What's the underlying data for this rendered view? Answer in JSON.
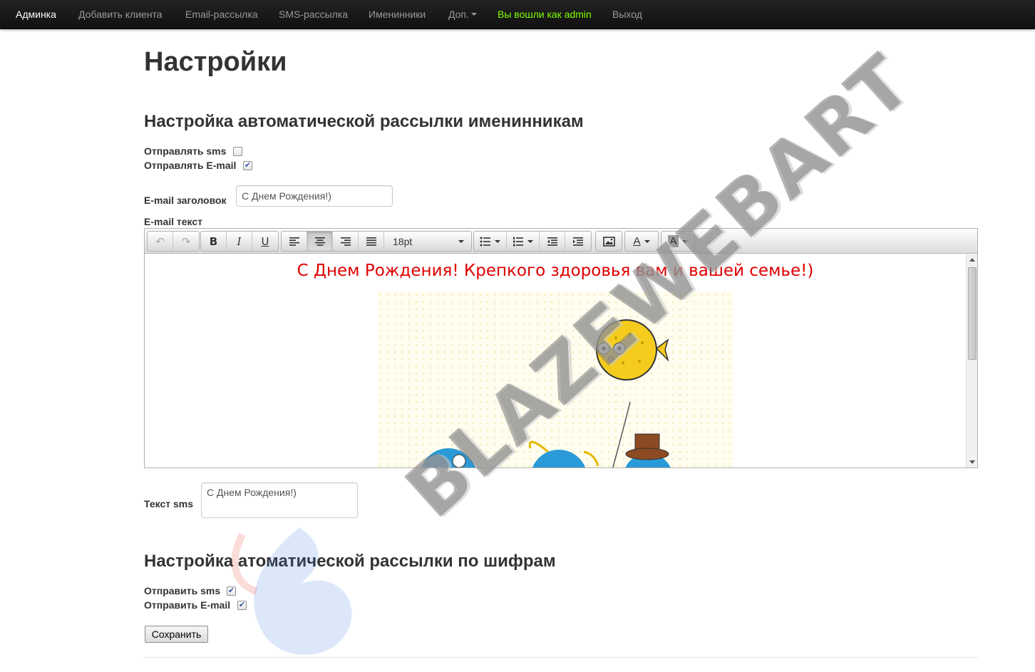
{
  "navbar": {
    "brand": "Админка",
    "items": [
      "Добавить клиента",
      "Email-рассылка",
      "SMS-рассылка",
      "Именинники",
      "Доп."
    ],
    "user": "Вы вошли как admin",
    "logout": "Выход"
  },
  "page": {
    "title": "Настройки"
  },
  "birthday": {
    "heading": "Настройка автоматической рассылки именинникам",
    "send_sms_label": "Отправлять sms",
    "send_sms_checked": false,
    "send_email_label": "Отправлять E-mail",
    "send_email_checked": true,
    "email_subject_label": "E-mail заголовок",
    "email_subject_value": "С Днем Рождения!)",
    "email_text_label": "E-mail текст",
    "sms_text_label": "Текст sms",
    "sms_text_value": "С Днем Рождения!)"
  },
  "editor": {
    "font_size": "18pt",
    "toolbar_icons": [
      "undo-icon",
      "redo-icon",
      "bold-icon",
      "italic-icon",
      "underline-icon",
      "align-left-icon",
      "align-center-icon",
      "align-right-icon",
      "align-justify-icon",
      "font-size-select",
      "bullet-list-icon",
      "numbered-list-icon",
      "outdent-icon",
      "indent-icon",
      "image-icon",
      "text-color-icon",
      "background-color-icon"
    ],
    "bold_glyph": "B",
    "italic_glyph": "I",
    "underline_glyph": "U",
    "text_color_glyph": "A",
    "bg_color_glyph": "A",
    "greeting": "С Днем Рождения! Крепкого здоровья вам и вашей семье!)",
    "greeting_color": "#e00000"
  },
  "cipher": {
    "heading": "Настройка атоматической рассылки по шифрам",
    "send_sms_label": "Отправить sms",
    "send_sms_checked": true,
    "send_email_label": "Отправить E-mail",
    "send_email_checked": true
  },
  "actions": {
    "save_label": "Сохранить"
  },
  "watermark": {
    "text": "BLAZEWEBART"
  },
  "colors": {
    "nav_bg": "#1b1b1b",
    "nav_text": "#999999",
    "nav_user": "#7fff00"
  }
}
